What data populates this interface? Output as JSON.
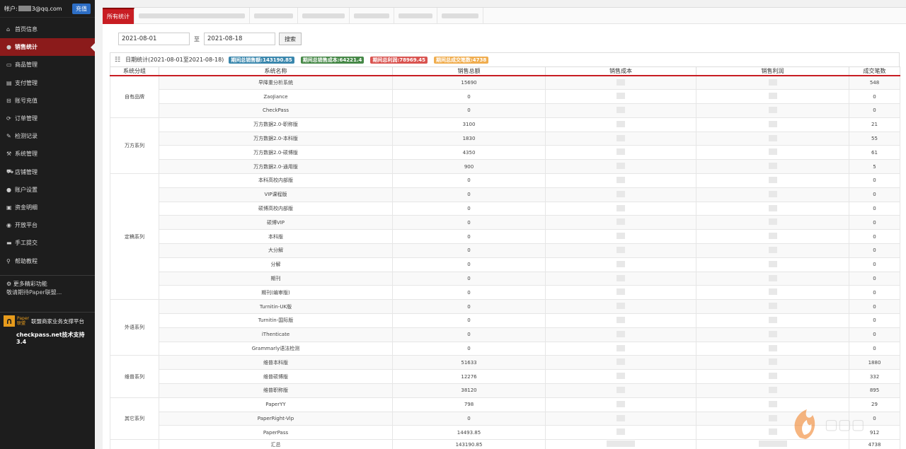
{
  "account": {
    "label": "帐户:",
    "email_suffix": "3@qq.com",
    "recharge": "充值"
  },
  "nav": [
    {
      "icon": "⌂",
      "label": "首页信息"
    },
    {
      "icon": "●",
      "label": "销售统计",
      "active": true
    },
    {
      "icon": "▭",
      "label": "商品管理"
    },
    {
      "icon": "▤",
      "label": "支付管理"
    },
    {
      "icon": "⊟",
      "label": "账号充值"
    },
    {
      "icon": "⟳",
      "label": "订单管理"
    },
    {
      "icon": "✎",
      "label": "检测记录"
    },
    {
      "icon": "⚒",
      "label": "系统管理"
    },
    {
      "icon": "⛟",
      "label": "店铺管理"
    },
    {
      "icon": "●",
      "label": "账户设置"
    },
    {
      "icon": "▣",
      "label": "资金明细"
    },
    {
      "icon": "◉",
      "label": "开放平台"
    },
    {
      "icon": "▬",
      "label": "手工提交"
    },
    {
      "icon": "⚲",
      "label": "帮助教程"
    }
  ],
  "more": {
    "title": "更多精彩功能",
    "sub": "敬请期待Paper联盟..."
  },
  "brand": {
    "logo_small": "Paper",
    "logo_cn": "联盟",
    "title": "联盟商家业务支撑平台",
    "sub": "checkpass.net技术支持 3.4"
  },
  "tabs": {
    "active": "所有统计"
  },
  "filter": {
    "start": "2021-08-01",
    "to": "至",
    "end": "2021-08-18",
    "search": "搜索"
  },
  "summary": {
    "title": "日期统计(2021-08-01至2021-08-18)",
    "badges": [
      {
        "text": "期间总销售额:143190.85",
        "color": "#3a87ad"
      },
      {
        "text": "期间总销售成本:64221.4",
        "color": "#468847"
      },
      {
        "text": "期间总利润:78969.45",
        "color": "#d9534f"
      },
      {
        "text": "期间总成交笔数:4738",
        "color": "#f0ad4e"
      }
    ]
  },
  "table": {
    "headers": [
      "系统分组",
      "系统名称",
      "销售总额",
      "销售成本",
      "销售利润",
      "成交笔数"
    ],
    "groups": [
      {
        "name": "自有品牌",
        "rows": [
          [
            "早降重分析系统",
            "15690",
            "548"
          ],
          [
            "ZaoJiance",
            "0",
            "0"
          ],
          [
            "CheckPass",
            "0",
            "0"
          ]
        ]
      },
      {
        "name": "万方系列",
        "rows": [
          [
            "万方数据2.0-职称版",
            "3100",
            "21"
          ],
          [
            "万方数据2.0-本科版",
            "1830",
            "55"
          ],
          [
            "万方数据2.0-硕博版",
            "4350",
            "61"
          ],
          [
            "万方数据2.0-通用版",
            "900",
            "5"
          ]
        ]
      },
      {
        "name": "定稿系列",
        "rows": [
          [
            "本科高校内部版",
            "0",
            "0"
          ],
          [
            "VIP课程版",
            "0",
            "0"
          ],
          [
            "硕博高校内部版",
            "0",
            "0"
          ],
          [
            "硕博VIP",
            "0",
            "0"
          ],
          [
            "本科版",
            "0",
            "0"
          ],
          [
            "大分解",
            "0",
            "0"
          ],
          [
            "分解",
            "0",
            "0"
          ],
          [
            "期刊",
            "0",
            "0"
          ],
          [
            "期刊(编审版)",
            "0",
            "0"
          ]
        ]
      },
      {
        "name": "外语系列",
        "rows": [
          [
            "Turnitin-UK版",
            "0",
            "0"
          ],
          [
            "Turnitin-国际版",
            "0",
            "0"
          ],
          [
            "iThenticate",
            "0",
            "0"
          ],
          [
            "Grammarly语法检测",
            "0",
            "0"
          ]
        ]
      },
      {
        "name": "维普系列",
        "rows": [
          [
            "维普本科版",
            "51633",
            "1880"
          ],
          [
            "维普硕博版",
            "12276",
            "332"
          ],
          [
            "维普职称版",
            "38120",
            "895"
          ]
        ]
      },
      {
        "name": "其它系列",
        "rows": [
          [
            "PaperYY",
            "798",
            "29"
          ],
          [
            "PaperRight-Vip",
            "0",
            "0"
          ],
          [
            "PaperPass",
            "14493.85",
            "912"
          ]
        ]
      }
    ],
    "total": {
      "label": "汇总",
      "sales": "143190.85",
      "count": "4738"
    }
  }
}
